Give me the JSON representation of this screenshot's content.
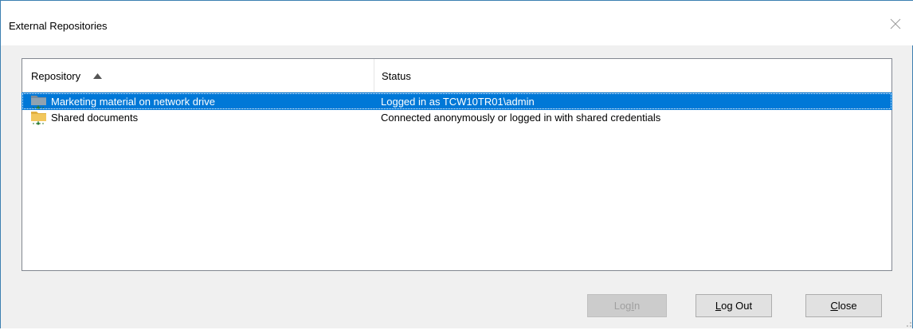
{
  "window": {
    "title": "External Repositories"
  },
  "list": {
    "columns": [
      {
        "label": "Repository",
        "sort": "ascending"
      },
      {
        "label": "Status"
      }
    ],
    "rows": [
      {
        "repository": "Marketing material on network drive",
        "status": "Logged in as TCW10TR01\\admin",
        "selected": true,
        "icon": "network-folder-icon-gray"
      },
      {
        "repository": "Shared documents",
        "status": "Connected anonymously or logged in with shared credentials",
        "selected": false,
        "icon": "network-folder-icon-yellow"
      }
    ]
  },
  "buttons": {
    "login": {
      "prefix": "Log ",
      "accel": "I",
      "suffix": "n",
      "enabled": false
    },
    "logout": {
      "prefix": "",
      "accel": "L",
      "suffix": "og Out",
      "enabled": true
    },
    "close": {
      "prefix": "",
      "accel": "C",
      "suffix": "lose",
      "enabled": true
    }
  },
  "colors": {
    "selection": "#0078d7",
    "window_border": "#3c7fb1"
  }
}
